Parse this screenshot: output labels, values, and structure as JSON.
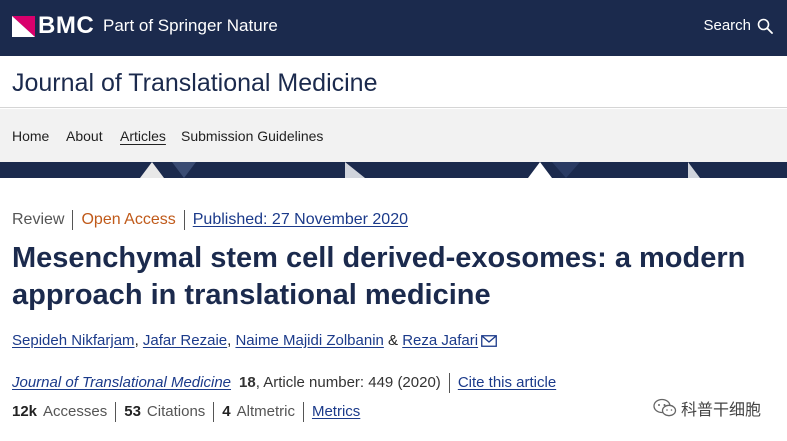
{
  "header": {
    "brand": "BMC",
    "brand_sub": "Part of Springer Nature",
    "search_label": "Search"
  },
  "journal": {
    "title": "Journal of Translational Medicine"
  },
  "nav": {
    "items": [
      {
        "label": "Home"
      },
      {
        "label": "About"
      },
      {
        "label": "Articles"
      },
      {
        "label": "Submission Guidelines"
      }
    ]
  },
  "article": {
    "type": "Review",
    "access": "Open Access",
    "published": "Published: 27 November 2020",
    "title": "Mesenchymal stem cell derived-exosomes: a modern approach in translational medicine",
    "authors": [
      {
        "name": "Sepideh Nikfarjam",
        "sep": ", "
      },
      {
        "name": "Jafar Rezaie",
        "sep": ", "
      },
      {
        "name": "Naime Majidi Zolbanin",
        "sep": " & "
      },
      {
        "name": "Reza Jafari",
        "sep": ""
      }
    ],
    "journal_name": "Journal of Translational Medicine",
    "volume": "18",
    "article_number": ", Article number: 449 (2020)",
    "cite_label": "Cite this article",
    "accesses_count": "12k",
    "accesses_label": "Accesses",
    "citations_count": "53",
    "citations_label": "Citations",
    "altmetric_count": "4",
    "altmetric_label": "Altmetric",
    "metrics_label": "Metrics"
  },
  "watermark": {
    "text": "科普干细胞"
  },
  "colors": {
    "navy": "#1b2a4d",
    "link": "#1b3a8a",
    "open_access": "#c05a1a",
    "nav_bg": "#f2f2f2"
  }
}
